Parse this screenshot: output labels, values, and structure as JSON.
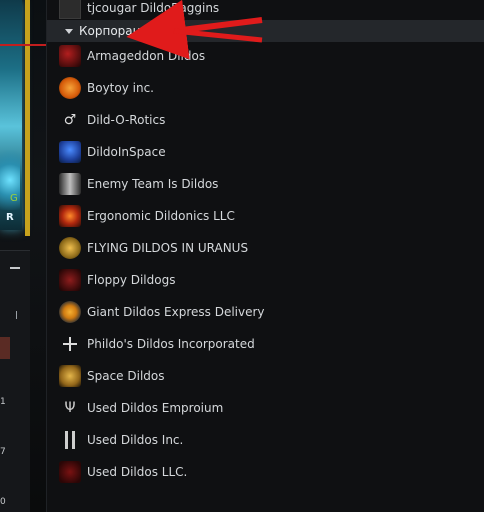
{
  "top_row": {
    "name": "tjcougar DildoBaggins"
  },
  "section": {
    "title": "Корпорации (14)"
  },
  "corporations": [
    {
      "name": "Armageddon Dildos",
      "icon": "armageddon-icon"
    },
    {
      "name": "Boytoy inc.",
      "icon": "boytoy-icon"
    },
    {
      "name": "Dild-O-Rotics",
      "icon": "male-symbol-icon"
    },
    {
      "name": "DildoInSpace",
      "icon": "dildoinspace-icon"
    },
    {
      "name": "Enemy Team Is Dildos",
      "icon": "enemy-team-icon"
    },
    {
      "name": "Ergonomic Dildonics LLC",
      "icon": "ergonomic-icon"
    },
    {
      "name": "FLYING DILDOS IN URANUS",
      "icon": "flying-dildos-icon"
    },
    {
      "name": "Floppy Dildogs",
      "icon": "floppy-dildogs-icon"
    },
    {
      "name": "Giant Dildos Express Delivery",
      "icon": "giant-dildos-icon"
    },
    {
      "name": "Phildo's Dildos Incorporated",
      "icon": "iron-cross-icon"
    },
    {
      "name": "Space Dildos",
      "icon": "space-dildos-icon"
    },
    {
      "name": "Used Dildos Emproium",
      "icon": "used-dildos-emporium-icon"
    },
    {
      "name": "Used Dildos Inc.",
      "icon": "used-dildos-inc-icon"
    },
    {
      "name": "Used Dildos LLC.",
      "icon": "used-dildos-llc-icon"
    }
  ],
  "left_bg": {
    "green": "G",
    "white": "R",
    "nums": [
      "1",
      "7",
      "0"
    ]
  },
  "colors": {
    "annotation_red": "#e01b1b",
    "header_bg": "#24272b",
    "panel_bg": "#0f1012"
  }
}
